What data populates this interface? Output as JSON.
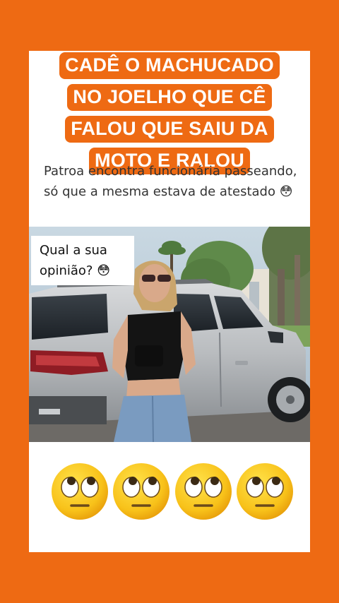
{
  "post": {
    "headline_lines": [
      "CADÊ O MACHUCADO",
      "NO JOELHO QUE CÊ",
      "FALOU QUE SAIU DA",
      "MOTO E RALOU"
    ],
    "caption_text": "Patroa encontra funcionária passeando, só que a mesma estava de atestado",
    "caption_emoji": "😳",
    "opinion_line1": "Qual a sua",
    "opinion_line2": "opinião?",
    "opinion_emoji": "😳",
    "reaction_icon": "face-with-rolling-eyes-icon",
    "reaction_count": 4
  },
  "colors": {
    "background": "#EE6A13",
    "card": "#FFFFFF",
    "headline_text": "#FFFFFF",
    "caption_text": "#333333"
  }
}
